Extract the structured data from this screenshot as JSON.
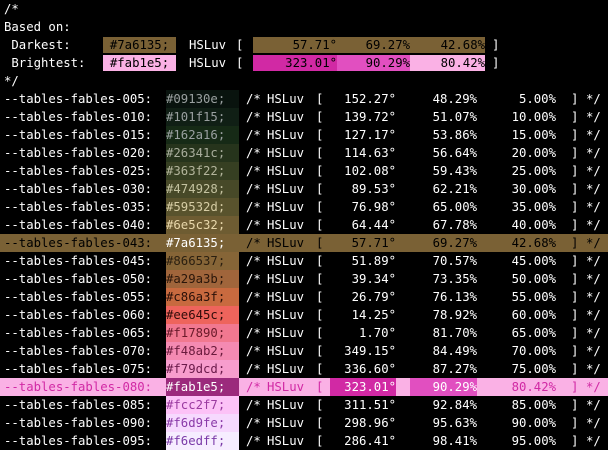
{
  "header": {
    "open": "/*",
    "based_on": "Based on:",
    "darkest_label": " Darkest:",
    "brightest_label": " Brightest:",
    "close": "*/",
    "darkest": {
      "hex": "#7a6135;",
      "space": "HSLuv",
      "h": "57.71°",
      "s": "69.27%",
      "l": "42.68%",
      "color": "#7a6135",
      "h_bg": "#7a6135",
      "s_bg": "#7a6135",
      "l_bg": "#7a6135",
      "text_color": "#000000"
    },
    "brightest": {
      "hex": "#fab1e5;",
      "space": "HSLuv",
      "h": "323.01°",
      "s": "90.29%",
      "l": "80.42%",
      "color": "#fab1e5",
      "h_bg": "#d129a4",
      "s_bg": "#e14fc0",
      "l_bg": "#fab1e5",
      "text_color": "#000000"
    }
  },
  "syntax": {
    "comment_open": "/*",
    "comment_close": "*/",
    "space": "HSLuv",
    "bracket_open": "[",
    "bracket_close": "]"
  },
  "rows": [
    {
      "name": "--tables-fables-005:",
      "hex": "#09130e;",
      "h": "152.27°",
      "s": "48.29%",
      "l": "5.00%",
      "color": "#09130e",
      "text_color": "#9aa0a0"
    },
    {
      "name": "--tables-fables-010:",
      "hex": "#101f15;",
      "h": "139.72°",
      "s": "51.07%",
      "l": "10.00%",
      "color": "#101f15",
      "text_color": "#9aa0a0"
    },
    {
      "name": "--tables-fables-015:",
      "hex": "#162a16;",
      "h": "127.17°",
      "s": "53.86%",
      "l": "15.00%",
      "color": "#162a16",
      "text_color": "#9aa0a0"
    },
    {
      "name": "--tables-fables-020:",
      "hex": "#26341c;",
      "h": "114.63°",
      "s": "56.64%",
      "l": "20.00%",
      "color": "#26341c",
      "text_color": "#a8ad9c"
    },
    {
      "name": "--tables-fables-025:",
      "hex": "#363f22;",
      "h": "102.08°",
      "s": "59.43%",
      "l": "25.00%",
      "color": "#363f22",
      "text_color": "#b3b59c"
    },
    {
      "name": "--tables-fables-030:",
      "hex": "#474928;",
      "h": "89.53°",
      "s": "62.21%",
      "l": "30.00%",
      "color": "#474928",
      "text_color": "#c4c2a0"
    },
    {
      "name": "--tables-fables-035:",
      "hex": "#59532d;",
      "h": "76.98°",
      "s": "65.00%",
      "l": "35.00%",
      "color": "#59532d",
      "text_color": "#d6cca4"
    },
    {
      "name": "--tables-fables-040:",
      "hex": "#6e5c32;",
      "h": "64.44°",
      "s": "67.78%",
      "l": "40.00%",
      "color": "#6e5c32",
      "text_color": "#e8d7aa"
    },
    {
      "name": "--tables-fables-043:",
      "hex": "#7a6135;",
      "h": "57.71°",
      "s": "69.27%",
      "l": "42.68%",
      "color": "#7a6135",
      "text_color": "#ffffff",
      "highlight": "brown"
    },
    {
      "name": "--tables-fables-045:",
      "hex": "#866537;",
      "h": "51.89°",
      "s": "70.57%",
      "l": "45.00%",
      "color": "#866537",
      "text_color": "#2a1f10"
    },
    {
      "name": "--tables-fables-050:",
      "hex": "#a29a3b;",
      "h": "39.34°",
      "s": "73.35%",
      "l": "50.00%",
      "color": "#a0653b",
      "text_color": "#2a160a"
    },
    {
      "name": "--tables-fables-055:",
      "hex": "#c86a3f;",
      "h": "26.79°",
      "s": "76.13%",
      "l": "55.00%",
      "color": "#c86a3f",
      "text_color": "#2a1008"
    },
    {
      "name": "--tables-fables-060:",
      "hex": "#ee645c;",
      "h": "14.25°",
      "s": "78.92%",
      "l": "60.00%",
      "color": "#ee645c",
      "text_color": "#300c0a"
    },
    {
      "name": "--tables-fables-065:",
      "hex": "#f17890;",
      "h": "1.70°",
      "s": "81.70%",
      "l": "65.00%",
      "color": "#f17890",
      "text_color": "#6a1a2a"
    },
    {
      "name": "--tables-fables-070:",
      "hex": "#f48ab2;",
      "h": "349.15°",
      "s": "84.49%",
      "l": "70.00%",
      "color": "#f48ab2",
      "text_color": "#6a1a3c"
    },
    {
      "name": "--tables-fables-075:",
      "hex": "#f79dcd;",
      "h": "336.60°",
      "s": "87.27%",
      "l": "75.00%",
      "color": "#f79dcd",
      "text_color": "#6a1a4a"
    },
    {
      "name": "--tables-fables-080:",
      "hex": "#fab1e5;",
      "h": "323.01°",
      "s": "90.29%",
      "l": "80.42%",
      "color": "#fab1e5",
      "text_color": "#ffffff",
      "highlight": "pink"
    },
    {
      "name": "--tables-fables-085:",
      "hex": "#fcc2f7;",
      "h": "311.51°",
      "s": "92.84%",
      "l": "85.00%",
      "color": "#fcc2f7",
      "text_color": "#9a3aa0"
    },
    {
      "name": "--tables-fables-090:",
      "hex": "#f6d9fe;",
      "h": "298.96°",
      "s": "95.63%",
      "l": "90.00%",
      "color": "#f6d9fe",
      "text_color": "#8a3aa8"
    },
    {
      "name": "--tables-fables-095:",
      "hex": "#f6edff;",
      "h": "286.41°",
      "s": "98.41%",
      "l": "95.00%",
      "color": "#f6edff",
      "text_color": "#7a3aa8"
    }
  ]
}
